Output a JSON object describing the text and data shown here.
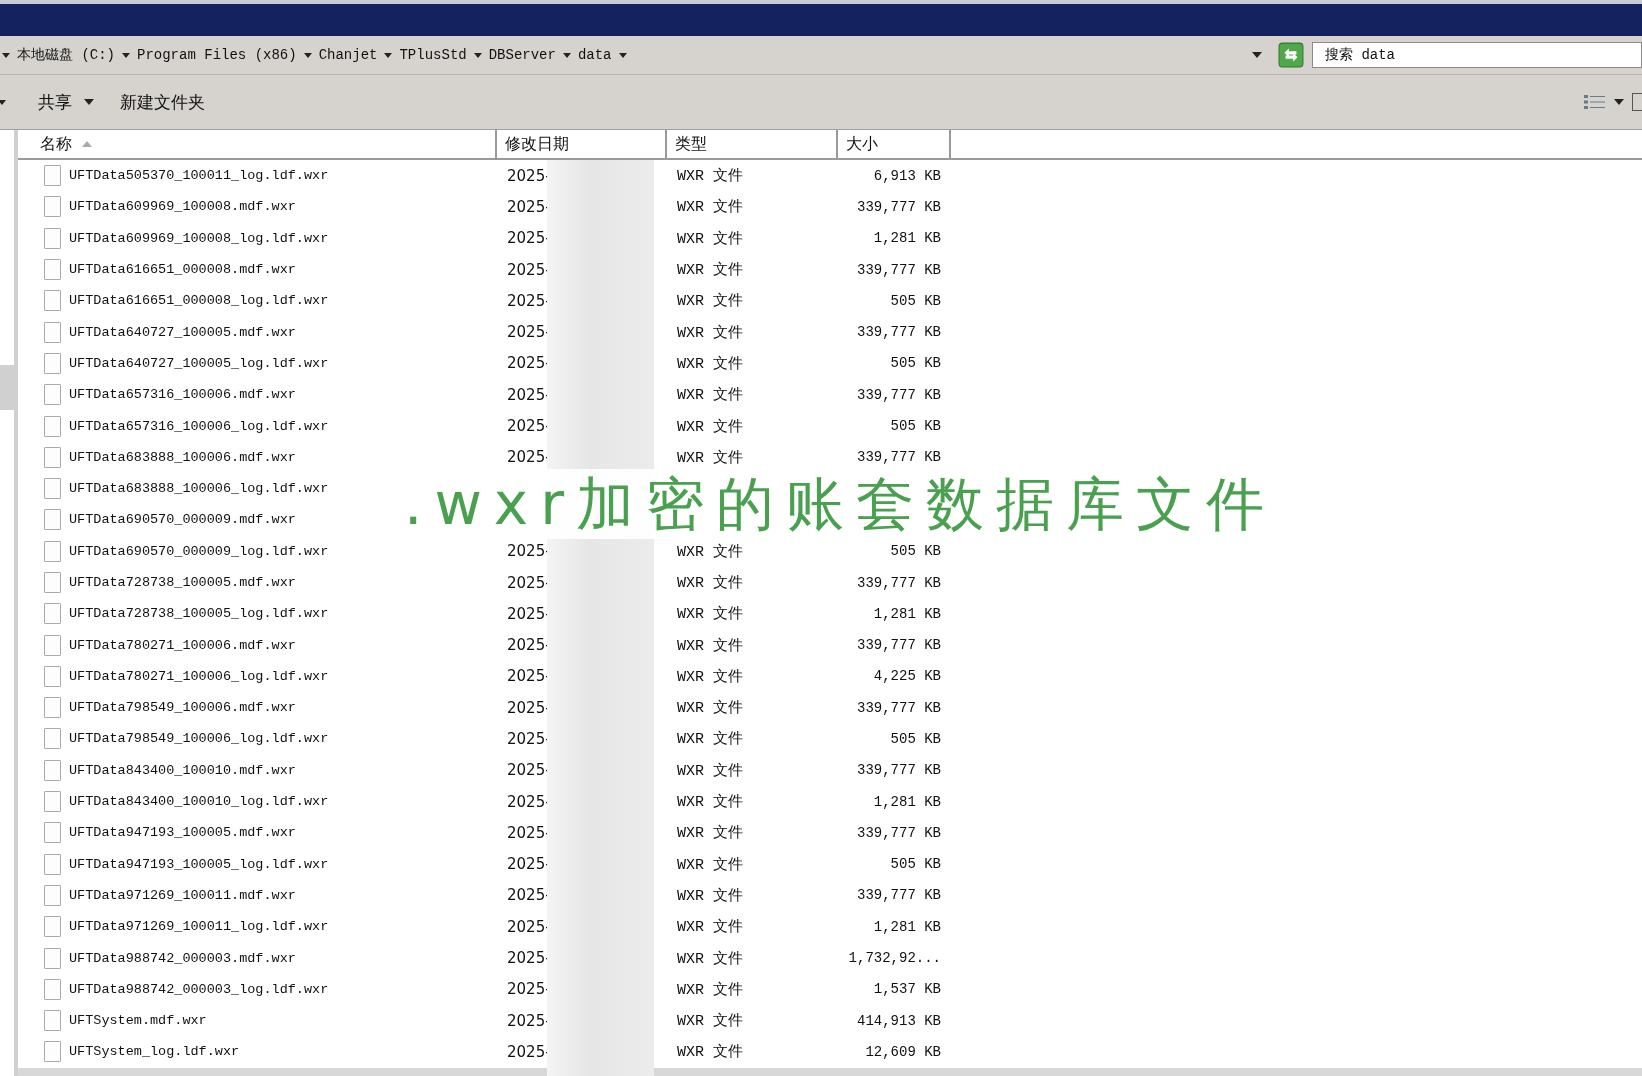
{
  "address_bar": {
    "path": [
      {
        "label": "本地磁盘 (C:)"
      },
      {
        "label": "Program Files (x86)"
      },
      {
        "label": "Chanjet"
      },
      {
        "label": "TPlusStd"
      },
      {
        "label": "DBServer"
      },
      {
        "label": "data"
      }
    ],
    "search": {
      "placeholder": "搜索 data"
    }
  },
  "toolbar": {
    "buttons": [
      {
        "label": "共享",
        "kind": "dropdown"
      },
      {
        "label": "新建文件夹",
        "kind": "plain"
      }
    ]
  },
  "table": {
    "columns": [
      {
        "label": "名称",
        "sorted": true
      },
      {
        "label": "修改日期",
        "sorted": false
      },
      {
        "label": "类型",
        "sorted": false
      },
      {
        "label": "大小",
        "sorted": false
      }
    ],
    "rows": [
      {
        "name": "UFTData505370_100011_log.ldf.wxr",
        "date": "2025-",
        "type": "WXR 文件",
        "size": "6,913 KB"
      },
      {
        "name": "UFTData609969_100008.mdf.wxr",
        "date": "2025-",
        "type": "WXR 文件",
        "size": "339,777 KB"
      },
      {
        "name": "UFTData609969_100008_log.ldf.wxr",
        "date": "2025-",
        "type": "WXR 文件",
        "size": "1,281 KB"
      },
      {
        "name": "UFTData616651_000008.mdf.wxr",
        "date": "2025-",
        "type": "WXR 文件",
        "size": "339,777 KB"
      },
      {
        "name": "UFTData616651_000008_log.ldf.wxr",
        "date": "2025-",
        "type": "WXR 文件",
        "size": "505 KB"
      },
      {
        "name": "UFTData640727_100005.mdf.wxr",
        "date": "2025-",
        "type": "WXR 文件",
        "size": "339,777 KB"
      },
      {
        "name": "UFTData640727_100005_log.ldf.wxr",
        "date": "2025-",
        "type": "WXR 文件",
        "size": "505 KB"
      },
      {
        "name": "UFTData657316_100006.mdf.wxr",
        "date": "2025-",
        "type": "WXR 文件",
        "size": "339,777 KB"
      },
      {
        "name": "UFTData657316_100006_log.ldf.wxr",
        "date": "2025-",
        "type": "WXR 文件",
        "size": "505 KB"
      },
      {
        "name": "UFTData683888_100006.mdf.wxr",
        "date": "2025-",
        "type": "WXR 文件",
        "size": "339,777 KB"
      },
      {
        "name": "UFTData683888_100006_log.ldf.wxr"
      },
      {
        "name": "UFTData690570_000009.mdf.wxr"
      },
      {
        "name": "UFTData690570_000009_log.ldf.wxr",
        "date": "2025-",
        "type": "WXR 文件",
        "size": "505 KB"
      },
      {
        "name": "UFTData728738_100005.mdf.wxr",
        "date": "2025-",
        "type": "WXR 文件",
        "size": "339,777 KB"
      },
      {
        "name": "UFTData728738_100005_log.ldf.wxr",
        "date": "2025-",
        "type": "WXR 文件",
        "size": "1,281 KB"
      },
      {
        "name": "UFTData780271_100006.mdf.wxr",
        "date": "2025-",
        "type": "WXR 文件",
        "size": "339,777 KB"
      },
      {
        "name": "UFTData780271_100006_log.ldf.wxr",
        "date": "2025-",
        "type": "WXR 文件",
        "size": "4,225 KB"
      },
      {
        "name": "UFTData798549_100006.mdf.wxr",
        "date": "2025-",
        "type": "WXR 文件",
        "size": "339,777 KB"
      },
      {
        "name": "UFTData798549_100006_log.ldf.wxr",
        "date": "2025-",
        "type": "WXR 文件",
        "size": "505 KB"
      },
      {
        "name": "UFTData843400_100010.mdf.wxr",
        "date": "2025-",
        "type": "WXR 文件",
        "size": "339,777 KB"
      },
      {
        "name": "UFTData843400_100010_log.ldf.wxr",
        "date": "2025-",
        "type": "WXR 文件",
        "size": "1,281 KB"
      },
      {
        "name": "UFTData947193_100005.mdf.wxr",
        "date": "2025-",
        "type": "WXR 文件",
        "size": "339,777 KB"
      },
      {
        "name": "UFTData947193_100005_log.ldf.wxr",
        "date": "2025-",
        "type": "WXR 文件",
        "size": "505 KB"
      },
      {
        "name": "UFTData971269_100011.mdf.wxr",
        "date": "2025-",
        "type": "WXR 文件",
        "size": "339,777 KB"
      },
      {
        "name": "UFTData971269_100011_log.ldf.wxr",
        "date": "2025-",
        "type": "WXR 文件",
        "size": "1,281 KB"
      },
      {
        "name": "UFTData988742_000003.mdf.wxr",
        "date": "2025-",
        "type": "WXR 文件",
        "size": "1,732,92..."
      },
      {
        "name": "UFTData988742_000003_log.ldf.wxr",
        "date": "2025-",
        "type": "WXR 文件",
        "size": "1,537 KB"
      },
      {
        "name": "UFTSystem.mdf.wxr",
        "date": "2025-",
        "type": "WXR 文件",
        "size": "414,913 KB"
      },
      {
        "name": "UFTSystem_log.ldf.wxr",
        "date": "2025-",
        "type": "WXR 文件",
        "size": "12,609 KB"
      }
    ]
  },
  "overlay_caption": ".wxr加密的账套数据库文件"
}
